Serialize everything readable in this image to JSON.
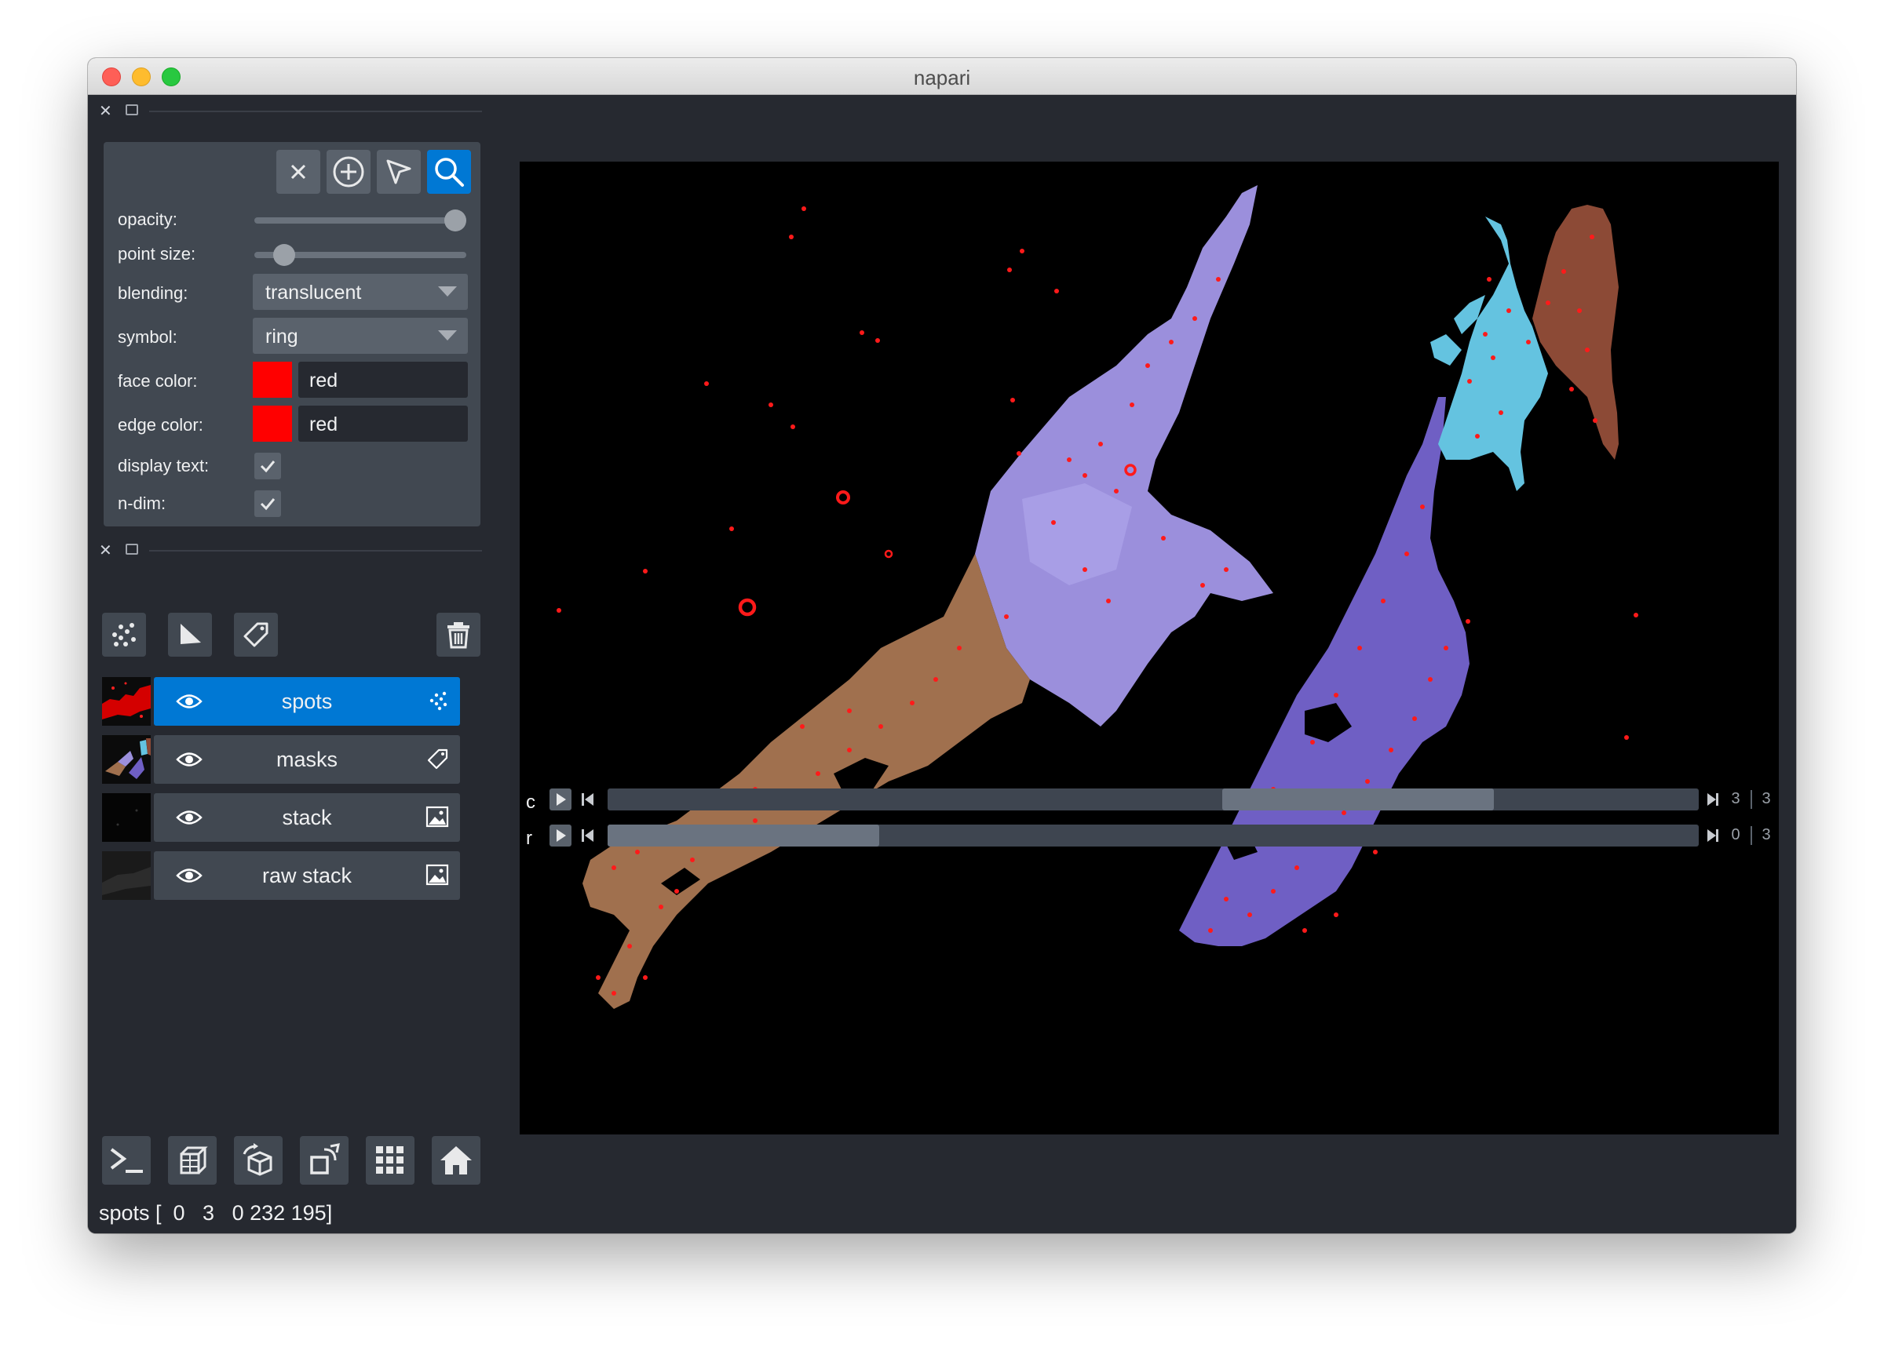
{
  "window": {
    "title": "napari"
  },
  "controls": {
    "opacity_label": "opacity:",
    "opacity_value": 1.0,
    "point_size_label": "point size:",
    "point_size_value": 0.1,
    "blending_label": "blending:",
    "blending_value": "translucent",
    "symbol_label": "symbol:",
    "symbol_value": "ring",
    "face_color_label": "face color:",
    "face_color_value": "red",
    "face_color_hex": "#ff0000",
    "edge_color_label": "edge color:",
    "edge_color_value": "red",
    "edge_color_hex": "#ff0000",
    "display_text_label": "display text:",
    "display_text_checked": true,
    "ndim_label": "n-dim:",
    "ndim_checked": true
  },
  "layers": [
    {
      "name": "spots",
      "type": "points",
      "selected": true,
      "visible": true
    },
    {
      "name": "masks",
      "type": "labels",
      "selected": false,
      "visible": true
    },
    {
      "name": "stack",
      "type": "image",
      "selected": false,
      "visible": true
    },
    {
      "name": "raw stack",
      "type": "image",
      "selected": false,
      "visible": true
    }
  ],
  "status": "spots [  0   3   0 232 195]",
  "dims": [
    {
      "label": "c",
      "value": "3",
      "max": "3",
      "position_fraction": 0.75
    },
    {
      "label": "r",
      "value": "0",
      "max": "3",
      "position_fraction": 0.0
    }
  ],
  "colors": {
    "accent": "#0078d4",
    "background": "#262930",
    "panel": "#414851",
    "cell_lavender": "#9b8fdc",
    "cell_violet": "#6f5fc4",
    "cell_cyan": "#64c3e0",
    "cell_brown": "#8c4a36",
    "cell_tan": "#a0704e",
    "spot": "#ff1a1a"
  }
}
